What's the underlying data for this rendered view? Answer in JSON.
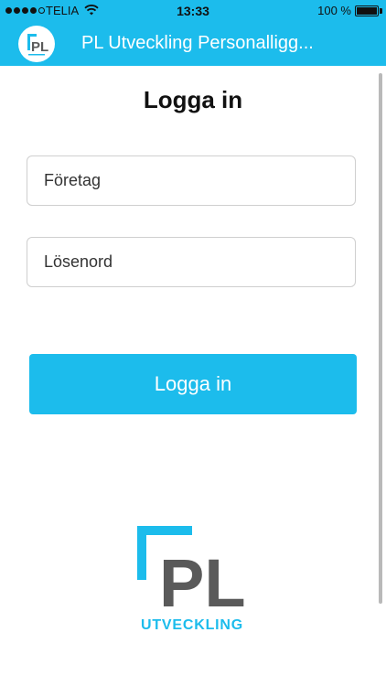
{
  "status_bar": {
    "carrier": "TELIA",
    "time": "13:33",
    "battery": "100 %",
    "signal_bars_filled": 4,
    "signal_bars_total": 5
  },
  "app_bar": {
    "logo_icon": "pl-utveckling-logo-icon",
    "title": "PL Utveckling Personalligg..."
  },
  "page": {
    "title": "Logga in"
  },
  "form": {
    "company_placeholder": "Företag",
    "password_placeholder": "Lösenord",
    "submit_label": "Logga in"
  },
  "brand": {
    "logo_text": "PL",
    "logo_subtitle": "UTVECKLING",
    "accent_color": "#1cbcec",
    "dark_color": "#5a5a5a"
  }
}
